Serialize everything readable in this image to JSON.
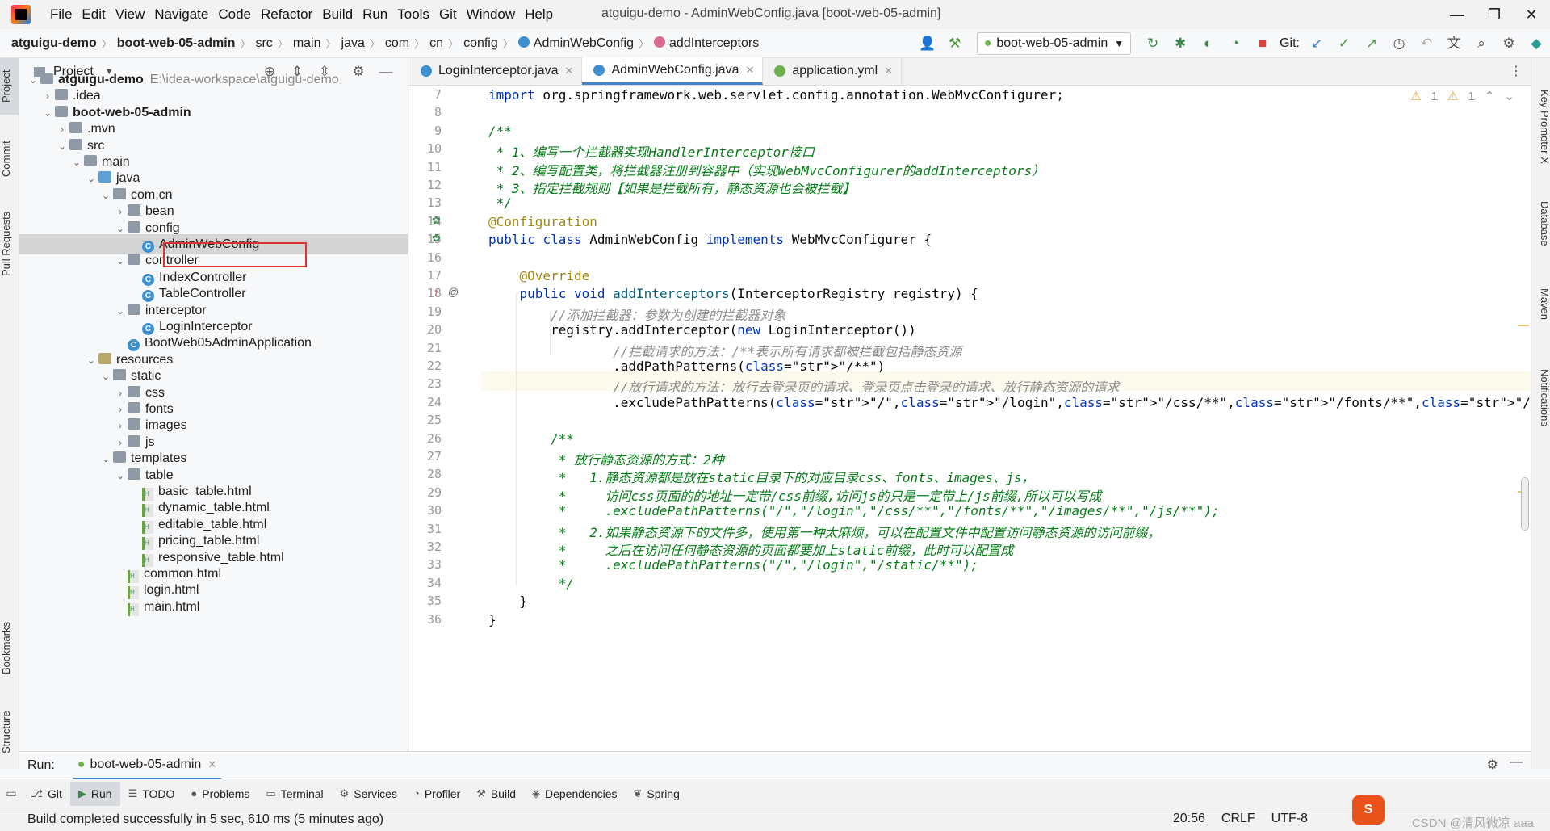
{
  "menubar": {
    "items": [
      "File",
      "Edit",
      "View",
      "Navigate",
      "Code",
      "Refactor",
      "Build",
      "Run",
      "Tools",
      "Git",
      "Window",
      "Help"
    ],
    "title": "atguigu-demo - AdminWebConfig.java [boot-web-05-admin]"
  },
  "nav": {
    "crumbs": [
      "atguigu-demo",
      "boot-web-05-admin",
      "src",
      "main",
      "java",
      "com",
      "cn",
      "config",
      "AdminWebConfig",
      "addInterceptors"
    ],
    "run_config": "boot-web-05-admin",
    "git_label": "Git:"
  },
  "left_stripe": [
    "Project",
    "Commit",
    "Pull Requests",
    "Bookmarks",
    "Structure"
  ],
  "right_stripe": [
    "Key Promoter X",
    "Database",
    "Maven",
    "Notifications"
  ],
  "project": {
    "header": "Project",
    "tree": [
      {
        "label": "atguigu-demo",
        "path": "E:\\idea-workspace\\atguigu-demo",
        "depth": 0,
        "arrow": "v",
        "icon": "folder",
        "bold": true
      },
      {
        "label": ".idea",
        "depth": 1,
        "arrow": ">",
        "icon": "folder"
      },
      {
        "label": "boot-web-05-admin",
        "depth": 1,
        "arrow": "v",
        "icon": "folder",
        "bold": true
      },
      {
        "label": ".mvn",
        "depth": 2,
        "arrow": ">",
        "icon": "folder"
      },
      {
        "label": "src",
        "depth": 2,
        "arrow": "v",
        "icon": "folder"
      },
      {
        "label": "main",
        "depth": 3,
        "arrow": "v",
        "icon": "folder"
      },
      {
        "label": "java",
        "depth": 4,
        "arrow": "v",
        "icon": "src"
      },
      {
        "label": "com.cn",
        "depth": 5,
        "arrow": "v",
        "icon": "folder"
      },
      {
        "label": "bean",
        "depth": 6,
        "arrow": ">",
        "icon": "folder"
      },
      {
        "label": "config",
        "depth": 6,
        "arrow": "v",
        "icon": "folder"
      },
      {
        "label": "AdminWebConfig",
        "depth": 7,
        "arrow": "",
        "icon": "class",
        "selected": true
      },
      {
        "label": "controller",
        "depth": 6,
        "arrow": "v",
        "icon": "folder"
      },
      {
        "label": "IndexController",
        "depth": 7,
        "arrow": "",
        "icon": "class"
      },
      {
        "label": "TableController",
        "depth": 7,
        "arrow": "",
        "icon": "class"
      },
      {
        "label": "interceptor",
        "depth": 6,
        "arrow": "v",
        "icon": "folder"
      },
      {
        "label": "LoginInterceptor",
        "depth": 7,
        "arrow": "",
        "icon": "class"
      },
      {
        "label": "BootWeb05AdminApplication",
        "depth": 6,
        "arrow": "",
        "icon": "class"
      },
      {
        "label": "resources",
        "depth": 4,
        "arrow": "v",
        "icon": "res"
      },
      {
        "label": "static",
        "depth": 5,
        "arrow": "v",
        "icon": "folder"
      },
      {
        "label": "css",
        "depth": 6,
        "arrow": ">",
        "icon": "folder"
      },
      {
        "label": "fonts",
        "depth": 6,
        "arrow": ">",
        "icon": "folder"
      },
      {
        "label": "images",
        "depth": 6,
        "arrow": ">",
        "icon": "folder"
      },
      {
        "label": "js",
        "depth": 6,
        "arrow": ">",
        "icon": "folder"
      },
      {
        "label": "templates",
        "depth": 5,
        "arrow": "v",
        "icon": "folder"
      },
      {
        "label": "table",
        "depth": 6,
        "arrow": "v",
        "icon": "folder"
      },
      {
        "label": "basic_table.html",
        "depth": 7,
        "arrow": "",
        "icon": "html"
      },
      {
        "label": "dynamic_table.html",
        "depth": 7,
        "arrow": "",
        "icon": "html"
      },
      {
        "label": "editable_table.html",
        "depth": 7,
        "arrow": "",
        "icon": "html"
      },
      {
        "label": "pricing_table.html",
        "depth": 7,
        "arrow": "",
        "icon": "html"
      },
      {
        "label": "responsive_table.html",
        "depth": 7,
        "arrow": "",
        "icon": "html"
      },
      {
        "label": "common.html",
        "depth": 6,
        "arrow": "",
        "icon": "html"
      },
      {
        "label": "login.html",
        "depth": 6,
        "arrow": "",
        "icon": "html"
      },
      {
        "label": "main.html",
        "depth": 6,
        "arrow": "",
        "icon": "html"
      }
    ]
  },
  "editor": {
    "tabs": [
      {
        "label": "LoginInterceptor.java",
        "active": false,
        "icon": "class"
      },
      {
        "label": "AdminWebConfig.java",
        "active": true,
        "icon": "class"
      },
      {
        "label": "application.yml",
        "active": false,
        "icon": "yml"
      }
    ],
    "inspections": {
      "warnings_a": "1",
      "warnings_b": "1"
    },
    "lines": [
      {
        "n": "7",
        "text": "import org.springframework.web.servlet.config.annotation.WebMvcConfigurer;",
        "style": "import"
      },
      {
        "n": "8",
        "text": "",
        "style": "plain"
      },
      {
        "n": "9",
        "text": "/**",
        "style": "doc"
      },
      {
        "n": "10",
        "text": " * 1、编写一个拦截器实现HandlerInterceptor接口",
        "style": "doc"
      },
      {
        "n": "11",
        "text": " * 2、编写配置类，将拦截器注册到容器中（实现WebMvcConfigurer的addInterceptors）",
        "style": "doc"
      },
      {
        "n": "12",
        "text": " * 3、指定拦截规则【如果是拦截所有，静态资源也会被拦截】",
        "style": "doc"
      },
      {
        "n": "13",
        "text": " */",
        "style": "doc"
      },
      {
        "n": "14",
        "text": "@Configuration",
        "style": "ann"
      },
      {
        "n": "15",
        "text": "public class AdminWebConfig implements WebMvcConfigurer {",
        "style": "classdecl"
      },
      {
        "n": "16",
        "text": "",
        "style": "plain"
      },
      {
        "n": "17",
        "text": "    @Override",
        "style": "ann"
      },
      {
        "n": "18",
        "text": "    public void addInterceptors(InterceptorRegistry registry) {",
        "style": "methoddecl"
      },
      {
        "n": "19",
        "text": "        //添加拦截器：参数为创建的拦截器对象",
        "style": "cmt"
      },
      {
        "n": "20",
        "text": "        registry.addInterceptor(new LoginInterceptor())",
        "style": "call"
      },
      {
        "n": "21",
        "text": "                //拦截请求的方法：/**表示所有请求都被拦截包括静态资源",
        "style": "cmt"
      },
      {
        "n": "22",
        "text": "                .addPathPatterns(\"/**\")",
        "style": "plain"
      },
      {
        "n": "23",
        "text": "                //放行请求的方法：放行去登录页的请求、登录页点击登录的请求、放行静态资源的请求",
        "style": "cmt"
      },
      {
        "n": "24",
        "text": "                .excludePathPatterns(\"/\",\"/login\",\"/css/**\",\"/fonts/**\",\"/images/**\",\"/js/**\");",
        "style": "plain"
      },
      {
        "n": "25",
        "text": "",
        "style": "plain"
      },
      {
        "n": "26",
        "text": "        /**",
        "style": "doc"
      },
      {
        "n": "27",
        "text": "         * 放行静态资源的方式：2种",
        "style": "doc"
      },
      {
        "n": "28",
        "text": "         *   1.静态资源都是放在static目录下的对应目录css、fonts、images、js，",
        "style": "doc"
      },
      {
        "n": "29",
        "text": "         *     访问css页面的的地址一定带/css前缀,访问js的只是一定带上/js前缀,所以可以写成",
        "style": "doc"
      },
      {
        "n": "30",
        "text": "         *     .excludePathPatterns(\"/\",\"/login\",\"/css/**\",\"/fonts/**\",\"/images/**\",\"/js/**\");",
        "style": "doc"
      },
      {
        "n": "31",
        "text": "         *   2.如果静态资源下的文件多，使用第一种太麻烦，可以在配置文件中配置访问静态资源的访问前缀，",
        "style": "doc"
      },
      {
        "n": "32",
        "text": "         *     之后在访问任何静态资源的页面都要加上static前缀，此时可以配置成",
        "style": "doc"
      },
      {
        "n": "33",
        "text": "         *     .excludePathPatterns(\"/\",\"/login\",\"/static/**\");",
        "style": "doc"
      },
      {
        "n": "34",
        "text": "         */",
        "style": "doc"
      },
      {
        "n": "35",
        "text": "    }",
        "style": "plain"
      },
      {
        "n": "36",
        "text": "}",
        "style": "plain"
      }
    ]
  },
  "run_panel": {
    "label": "Run:",
    "config": "boot-web-05-admin"
  },
  "bottom_tabs": [
    {
      "label": "Git",
      "icon": "⎇",
      "active": false
    },
    {
      "label": "Run",
      "icon": "▶",
      "active": true
    },
    {
      "label": "TODO",
      "icon": "☰",
      "active": false
    },
    {
      "label": "Problems",
      "icon": "●",
      "active": false
    },
    {
      "label": "Terminal",
      "icon": "▭",
      "active": false
    },
    {
      "label": "Services",
      "icon": "⚙",
      "active": false
    },
    {
      "label": "Profiler",
      "icon": "◔",
      "active": false
    },
    {
      "label": "Build",
      "icon": "⚒",
      "active": false
    },
    {
      "label": "Dependencies",
      "icon": "◈",
      "active": false
    },
    {
      "label": "Spring",
      "icon": "❦",
      "active": false
    }
  ],
  "status": {
    "message": "Build completed successfully in 5 sec, 610 ms (5 minutes ago)",
    "position": "20:56",
    "line_sep": "CRLF",
    "encoding": "UTF-8",
    "watermark": "CSDN @清风微凉 aaa"
  },
  "colors": {
    "accent": "#4083c9",
    "keyword": "#0033b3",
    "annotation": "#9e880d",
    "doc_comment": "#067d17",
    "highlight_box": "#e03131"
  }
}
